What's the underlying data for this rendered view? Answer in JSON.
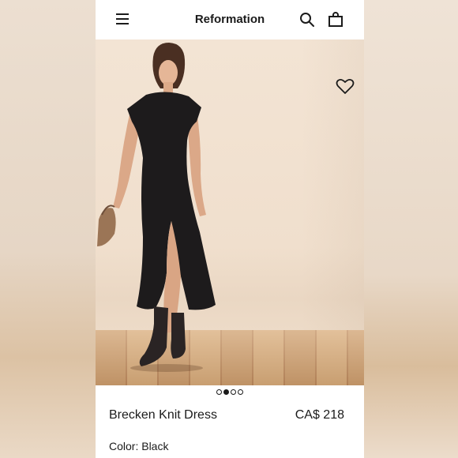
{
  "app": {
    "brand": "Reformation"
  },
  "header": {
    "icons": {
      "menu": "menu-icon",
      "search": "search-icon",
      "bag": "shopping-bag-icon"
    }
  },
  "gallery": {
    "favorite_icon": "heart-icon",
    "pages_total": 4,
    "active_page": 2
  },
  "product": {
    "name": "Brecken Knit Dress",
    "price": "CA$ 218",
    "color_label": "Color:",
    "color_value": "Black",
    "color_line": "Color: Black"
  }
}
